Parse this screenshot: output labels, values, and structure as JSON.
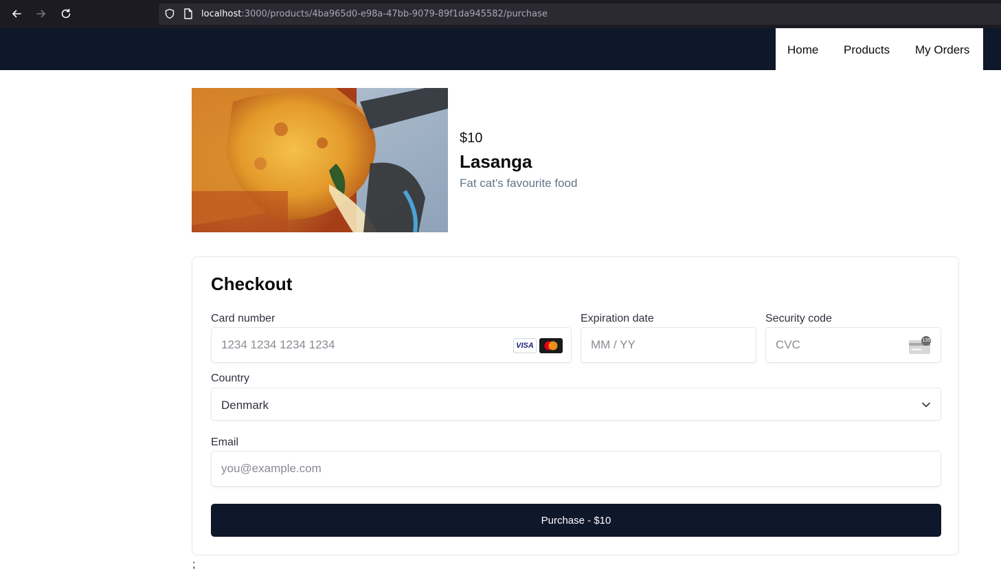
{
  "browser": {
    "url_host": "localhost",
    "url_rest": ":3000/products/4ba965d0-e98a-47bb-9079-89f1da945582/purchase"
  },
  "nav": {
    "home": "Home",
    "products": "Products",
    "orders": "My Orders"
  },
  "product": {
    "price": "$10",
    "name": "Lasanga",
    "description": "Fat cat's favourite food"
  },
  "checkout": {
    "title": "Checkout",
    "card_number_label": "Card number",
    "card_number_placeholder": "1234 1234 1234 1234",
    "expiration_label": "Expiration date",
    "expiration_placeholder": "MM / YY",
    "security_label": "Security code",
    "security_placeholder": "CVC",
    "cvc_badge": "135",
    "visa_text": "VISA",
    "country_label": "Country",
    "country_value": "Denmark",
    "email_label": "Email",
    "email_placeholder": "you@example.com",
    "purchase_label": "Purchase - $10"
  },
  "stray_text": ";",
  "colors": {
    "header_bg": "#0f172a",
    "button_bg": "#0f172a",
    "muted_text": "#64748b"
  }
}
